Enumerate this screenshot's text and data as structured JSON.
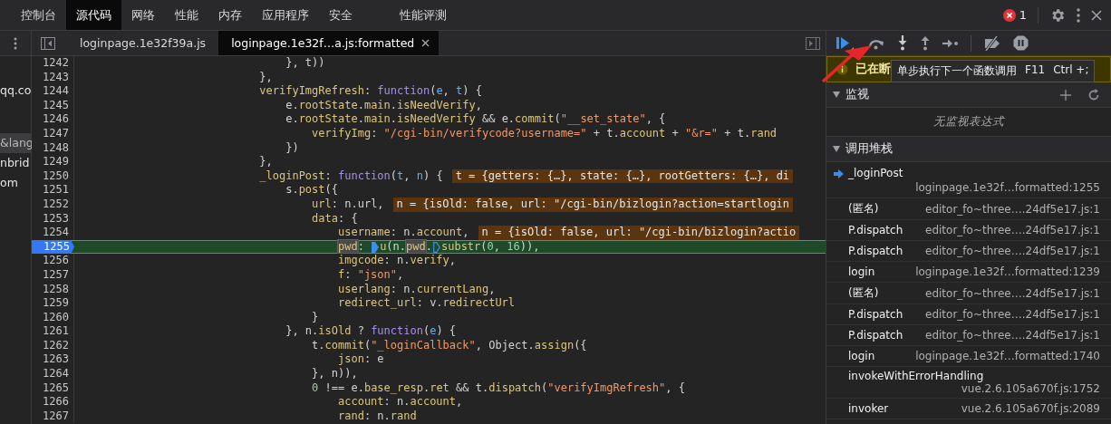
{
  "main_tabs": [
    {
      "label": "控制台",
      "selected": false
    },
    {
      "label": "源代码",
      "selected": true
    },
    {
      "label": "网络",
      "selected": false
    },
    {
      "label": "性能",
      "selected": false
    },
    {
      "label": "内存",
      "selected": false
    },
    {
      "label": "应用程序",
      "selected": false
    },
    {
      "label": "安全",
      "selected": false
    },
    {
      "label": "性能评测",
      "selected": false
    }
  ],
  "error_count": "1",
  "navigator": {
    "items": [
      {
        "label": "qq.co",
        "selected": false
      },
      {
        "label": "&lang",
        "selected": true
      },
      {
        "label": "nbrid",
        "selected": false
      },
      {
        "label": "om",
        "selected": false
      }
    ]
  },
  "file_tabs": [
    {
      "label": "loginpage.1e32f39a.js",
      "selected": false,
      "closable": false
    },
    {
      "label": "loginpage.1e32f…a.js:formatted",
      "selected": true,
      "closable": true
    }
  ],
  "editor": {
    "lines": [
      {
        "number": "1242",
        "current": false,
        "segments": [
          {
            "kind": "code",
            "tokens": [
              {
                "kind": "plain",
                "text": "                                }, t))"
              }
            ]
          }
        ]
      },
      {
        "number": "1243",
        "current": false,
        "segments": [
          {
            "kind": "code",
            "tokens": [
              {
                "kind": "plain",
                "text": "                            },"
              }
            ]
          }
        ]
      },
      {
        "number": "1244",
        "current": false,
        "segments": [
          {
            "kind": "code",
            "tokens": [
              {
                "kind": "property",
                "text": "                            verifyImgRefresh"
              },
              {
                "kind": "plain",
                "text": ": "
              },
              {
                "kind": "keyword",
                "text": "function"
              },
              {
                "kind": "plain",
                "text": "("
              },
              {
                "kind": "param",
                "text": "e"
              },
              {
                "kind": "plain",
                "text": ", "
              },
              {
                "kind": "param",
                "text": "t"
              },
              {
                "kind": "plain",
                "text": ") {"
              }
            ]
          }
        ]
      },
      {
        "number": "1245",
        "current": false,
        "segments": [
          {
            "kind": "code",
            "tokens": [
              {
                "kind": "plain",
                "text": "                                e."
              },
              {
                "kind": "property",
                "text": "rootState"
              },
              {
                "kind": "plain",
                "text": "."
              },
              {
                "kind": "property",
                "text": "main"
              },
              {
                "kind": "plain",
                "text": "."
              },
              {
                "kind": "property",
                "text": "isNeedVerify"
              },
              {
                "kind": "plain",
                "text": ","
              }
            ]
          }
        ]
      },
      {
        "number": "1246",
        "current": false,
        "segments": [
          {
            "kind": "code",
            "tokens": [
              {
                "kind": "plain",
                "text": "                                e."
              },
              {
                "kind": "property",
                "text": "rootState"
              },
              {
                "kind": "plain",
                "text": "."
              },
              {
                "kind": "property",
                "text": "main"
              },
              {
                "kind": "plain",
                "text": "."
              },
              {
                "kind": "property",
                "text": "isNeedVerify"
              },
              {
                "kind": "plain",
                "text": " && e."
              },
              {
                "kind": "property",
                "text": "commit"
              },
              {
                "kind": "plain",
                "text": "("
              },
              {
                "kind": "string",
                "text": "\"__set_state\""
              },
              {
                "kind": "plain",
                "text": ", {"
              }
            ]
          }
        ]
      },
      {
        "number": "1247",
        "current": false,
        "segments": [
          {
            "kind": "code",
            "tokens": [
              {
                "kind": "property",
                "text": "                                    verifyImg"
              },
              {
                "kind": "plain",
                "text": ": "
              },
              {
                "kind": "string",
                "text": "\"/cgi-bin/verifycode?username=\""
              },
              {
                "kind": "plain",
                "text": " + t."
              },
              {
                "kind": "property",
                "text": "account"
              },
              {
                "kind": "plain",
                "text": " + "
              },
              {
                "kind": "string",
                "text": "\"&r=\""
              },
              {
                "kind": "plain",
                "text": " + t."
              },
              {
                "kind": "property",
                "text": "rand"
              }
            ]
          }
        ]
      },
      {
        "number": "1248",
        "current": false,
        "segments": [
          {
            "kind": "code",
            "tokens": [
              {
                "kind": "plain",
                "text": "                                })"
              }
            ]
          }
        ]
      },
      {
        "number": "1249",
        "current": false,
        "segments": [
          {
            "kind": "code",
            "tokens": [
              {
                "kind": "plain",
                "text": "                            },"
              }
            ]
          }
        ]
      },
      {
        "number": "1250",
        "current": false,
        "segments": [
          {
            "kind": "code",
            "tokens": [
              {
                "kind": "property",
                "text": "                            _loginPost"
              },
              {
                "kind": "plain",
                "text": ": "
              },
              {
                "kind": "keyword",
                "text": "function"
              },
              {
                "kind": "plain",
                "text": "("
              },
              {
                "kind": "param",
                "text": "t"
              },
              {
                "kind": "plain",
                "text": ", "
              },
              {
                "kind": "param",
                "text": "n"
              },
              {
                "kind": "plain",
                "text": ") {"
              }
            ]
          },
          {
            "kind": "value",
            "text": "t = {getters: {…}, state: {…}, rootGetters: {…}, di"
          }
        ]
      },
      {
        "number": "1251",
        "current": false,
        "segments": [
          {
            "kind": "code",
            "tokens": [
              {
                "kind": "plain",
                "text": "                                s."
              },
              {
                "kind": "property",
                "text": "post"
              },
              {
                "kind": "plain",
                "text": "({"
              }
            ]
          }
        ]
      },
      {
        "number": "1252",
        "current": false,
        "segments": [
          {
            "kind": "code",
            "tokens": [
              {
                "kind": "property",
                "text": "                                    url"
              },
              {
                "kind": "plain",
                "text": ": n.url,"
              }
            ]
          },
          {
            "kind": "value",
            "text": "n = {isOld: false, url: \"/cgi-bin/bizlogin?action=startlogin"
          }
        ]
      },
      {
        "number": "1253",
        "current": false,
        "segments": [
          {
            "kind": "code",
            "tokens": [
              {
                "kind": "property",
                "text": "                                    data"
              },
              {
                "kind": "plain",
                "text": ": {"
              }
            ]
          }
        ]
      },
      {
        "number": "1254",
        "current": false,
        "segments": [
          {
            "kind": "code",
            "tokens": [
              {
                "kind": "property",
                "text": "                                        username"
              },
              {
                "kind": "plain",
                "text": ": n."
              },
              {
                "kind": "property",
                "text": "account"
              },
              {
                "kind": "plain",
                "text": ","
              }
            ]
          },
          {
            "kind": "value",
            "text": "n = {isOld: false, url: \"/cgi-bin/bizlogin?actio"
          }
        ]
      },
      {
        "number": "1255",
        "current": true,
        "segments": [
          {
            "kind": "code",
            "tokens": [
              {
                "kind": "highlight",
                "text": "                                        pwd"
              },
              {
                "kind": "plain",
                "text": ": "
              }
            ]
          },
          {
            "kind": "marker",
            "active": true
          },
          {
            "kind": "code",
            "tokens": [
              {
                "kind": "property",
                "text": "u"
              },
              {
                "kind": "plain",
                "text": "(n."
              },
              {
                "kind": "highlight",
                "text": "pwd"
              },
              {
                "kind": "plain",
                "text": "."
              }
            ]
          },
          {
            "kind": "marker",
            "active": false
          },
          {
            "kind": "code",
            "tokens": [
              {
                "kind": "property",
                "text": "substr"
              },
              {
                "kind": "plain",
                "text": "("
              },
              {
                "kind": "number",
                "text": "0"
              },
              {
                "kind": "plain",
                "text": ", "
              },
              {
                "kind": "number",
                "text": "16"
              },
              {
                "kind": "plain",
                "text": ")),"
              }
            ]
          }
        ]
      },
      {
        "number": "1256",
        "current": false,
        "segments": [
          {
            "kind": "code",
            "tokens": [
              {
                "kind": "property",
                "text": "                                        imgcode"
              },
              {
                "kind": "plain",
                "text": ": n."
              },
              {
                "kind": "property",
                "text": "verify"
              },
              {
                "kind": "plain",
                "text": ","
              }
            ]
          }
        ]
      },
      {
        "number": "1257",
        "current": false,
        "segments": [
          {
            "kind": "code",
            "tokens": [
              {
                "kind": "property",
                "text": "                                        f"
              },
              {
                "kind": "plain",
                "text": ": "
              },
              {
                "kind": "string",
                "text": "\"json\""
              },
              {
                "kind": "plain",
                "text": ","
              }
            ]
          }
        ]
      },
      {
        "number": "1258",
        "current": false,
        "segments": [
          {
            "kind": "code",
            "tokens": [
              {
                "kind": "property",
                "text": "                                        userlang"
              },
              {
                "kind": "plain",
                "text": ": n."
              },
              {
                "kind": "property",
                "text": "currentLang"
              },
              {
                "kind": "plain",
                "text": ","
              }
            ]
          }
        ]
      },
      {
        "number": "1259",
        "current": false,
        "segments": [
          {
            "kind": "code",
            "tokens": [
              {
                "kind": "property",
                "text": "                                        redirect_url"
              },
              {
                "kind": "plain",
                "text": ": v."
              },
              {
                "kind": "property",
                "text": "redirectUrl"
              }
            ]
          }
        ]
      },
      {
        "number": "1260",
        "current": false,
        "segments": [
          {
            "kind": "code",
            "tokens": [
              {
                "kind": "plain",
                "text": "                                    }"
              }
            ]
          }
        ]
      },
      {
        "number": "1261",
        "current": false,
        "segments": [
          {
            "kind": "code",
            "tokens": [
              {
                "kind": "plain",
                "text": "                                }, n."
              },
              {
                "kind": "property",
                "text": "isOld"
              },
              {
                "kind": "plain",
                "text": " ? "
              },
              {
                "kind": "keyword",
                "text": "function"
              },
              {
                "kind": "plain",
                "text": "("
              },
              {
                "kind": "param",
                "text": "e"
              },
              {
                "kind": "plain",
                "text": ") {"
              }
            ]
          }
        ]
      },
      {
        "number": "1262",
        "current": false,
        "segments": [
          {
            "kind": "code",
            "tokens": [
              {
                "kind": "plain",
                "text": "                                    t."
              },
              {
                "kind": "property",
                "text": "commit"
              },
              {
                "kind": "plain",
                "text": "("
              },
              {
                "kind": "string",
                "text": "\"_loginCallback\""
              },
              {
                "kind": "plain",
                "text": ", Object."
              },
              {
                "kind": "property",
                "text": "assign"
              },
              {
                "kind": "plain",
                "text": "({"
              }
            ]
          }
        ]
      },
      {
        "number": "1263",
        "current": false,
        "segments": [
          {
            "kind": "code",
            "tokens": [
              {
                "kind": "property",
                "text": "                                        json"
              },
              {
                "kind": "plain",
                "text": ": e"
              }
            ]
          }
        ]
      },
      {
        "number": "1264",
        "current": false,
        "segments": [
          {
            "kind": "code",
            "tokens": [
              {
                "kind": "plain",
                "text": "                                    }, n)),"
              }
            ]
          }
        ]
      },
      {
        "number": "1265",
        "current": false,
        "segments": [
          {
            "kind": "code",
            "tokens": [
              {
                "kind": "number",
                "text": "                                    0"
              },
              {
                "kind": "plain",
                "text": " !== e."
              },
              {
                "kind": "property",
                "text": "base_resp"
              },
              {
                "kind": "plain",
                "text": "."
              },
              {
                "kind": "property",
                "text": "ret"
              },
              {
                "kind": "plain",
                "text": " && t."
              },
              {
                "kind": "property",
                "text": "dispatch"
              },
              {
                "kind": "plain",
                "text": "("
              },
              {
                "kind": "string",
                "text": "\"verifyImgRefresh\""
              },
              {
                "kind": "plain",
                "text": ", {"
              }
            ]
          }
        ]
      },
      {
        "number": "1266",
        "current": false,
        "segments": [
          {
            "kind": "code",
            "tokens": [
              {
                "kind": "property",
                "text": "                                        account"
              },
              {
                "kind": "plain",
                "text": ": n."
              },
              {
                "kind": "property",
                "text": "account"
              },
              {
                "kind": "plain",
                "text": ","
              }
            ]
          }
        ]
      },
      {
        "number": "1267",
        "current": false,
        "segments": [
          {
            "kind": "code",
            "tokens": [
              {
                "kind": "property",
                "text": "                                        rand"
              },
              {
                "kind": "plain",
                "text": ": n."
              },
              {
                "kind": "property",
                "text": "rand"
              }
            ]
          }
        ]
      }
    ]
  },
  "debugger": {
    "toolbar": [
      {
        "kind": "resume"
      },
      {
        "kind": "step-over"
      },
      {
        "kind": "step-into"
      },
      {
        "kind": "step-out"
      },
      {
        "kind": "step"
      },
      {
        "kind": "divider"
      },
      {
        "kind": "deactivate"
      },
      {
        "kind": "pause-exceptions"
      }
    ],
    "banner": {
      "text": "已在断"
    },
    "tooltip": {
      "text": "单步执行下一个函数调用",
      "shortcuts": [
        "F11",
        "Ctrl +;"
      ]
    },
    "watch": {
      "title": "监视",
      "expanded": true,
      "empty_text": "无监视表达式"
    },
    "call_stack": {
      "title": "调用堆栈",
      "expanded": true,
      "frames": [
        {
          "name": "_loginPost",
          "location": "loginpage.1e32f…formatted:1255",
          "selected": true
        },
        {
          "name": "(匿名)",
          "location": "editor_fo~three….24df5e17.js:1",
          "selected": false
        },
        {
          "name": "P.dispatch",
          "location": "editor_fo~three….24df5e17.js:1",
          "selected": false
        },
        {
          "name": "P.dispatch",
          "location": "editor_fo~three….24df5e17.js:1",
          "selected": false
        },
        {
          "name": "login",
          "location": "loginpage.1e32f…formatted:1239",
          "selected": false
        },
        {
          "name": "(匿名)",
          "location": "editor_fo~three….24df5e17.js:1",
          "selected": false
        },
        {
          "name": "P.dispatch",
          "location": "editor_fo~three….24df5e17.js:1",
          "selected": false
        },
        {
          "name": "P.dispatch",
          "location": "editor_fo~three….24df5e17.js:1",
          "selected": false
        },
        {
          "name": "login",
          "location": "loginpage.1e32f…formatted:1740",
          "selected": false
        },
        {
          "name": "invokeWithErrorHandling",
          "location": "vue.2.6.105a670f.js:1752",
          "selected": false
        },
        {
          "name": "invoker",
          "location": "vue.2.6.105a670f.js:2089",
          "selected": false
        }
      ]
    }
  }
}
